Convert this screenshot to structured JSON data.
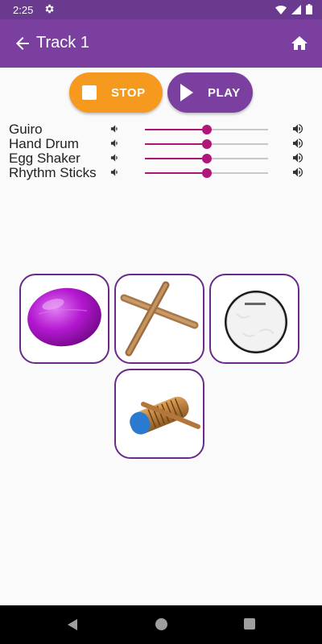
{
  "status_bar": {
    "time": "2:25"
  },
  "app_bar": {
    "title": "Track 1"
  },
  "controls": {
    "stop_label": "STOP",
    "play_label": "PLAY"
  },
  "mixer": {
    "tracks": [
      {
        "label": "Guiro",
        "volume": 0.5
      },
      {
        "label": "Hand Drum",
        "volume": 0.5
      },
      {
        "label": "Egg Shaker",
        "volume": 0.5
      },
      {
        "label": "Rhythm Sticks",
        "volume": 0.5
      }
    ]
  },
  "instruments": [
    {
      "name": "egg-shaker",
      "icon": "egg-shaker-image"
    },
    {
      "name": "rhythm-sticks",
      "icon": "rhythm-sticks-image"
    },
    {
      "name": "hand-drum",
      "icon": "hand-drum-image"
    },
    {
      "name": "guiro",
      "icon": "guiro-image"
    }
  ],
  "colors": {
    "primary": "#7b3fa0",
    "status_bar": "#6a3a8f",
    "stop": "#f59a1f",
    "slider": "#b0157a",
    "tile_border": "#6a2a8a"
  }
}
